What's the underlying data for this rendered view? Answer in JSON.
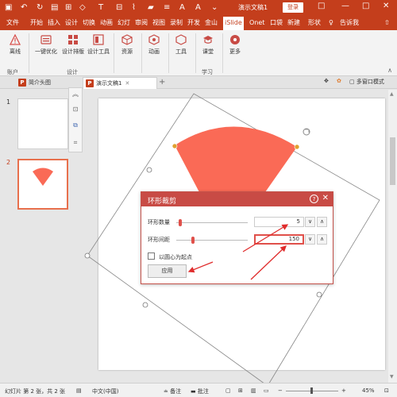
{
  "app": {
    "doc_title": "演示文稿1",
    "login_label": "登录",
    "ribbon_display_label": "□",
    "min_label": "—",
    "max_label": "□",
    "close_label": "✕",
    "save_icon": "save-icon",
    "undo_icon": "undo-icon"
  },
  "tabs": [
    {
      "label": "文件"
    },
    {
      "label": "开始"
    },
    {
      "label": "插入"
    },
    {
      "label": "设计"
    },
    {
      "label": "切换"
    },
    {
      "label": "动画"
    },
    {
      "label": "幻灯"
    },
    {
      "label": "审阅"
    },
    {
      "label": "视图"
    },
    {
      "label": "录制"
    },
    {
      "label": "开发"
    },
    {
      "label": "金山"
    },
    {
      "label": "iSlide"
    },
    {
      "label": "Onet"
    },
    {
      "label": "口袋"
    },
    {
      "label": "新建"
    },
    {
      "label": "形状"
    },
    {
      "label": "告诉我"
    }
  ],
  "ribbon": {
    "logout_label": "离线",
    "account_group": "账户",
    "optimize_label": "一键优化",
    "layout_label": "设计排版",
    "tools_label": "设计工具",
    "design_group": "设计",
    "resources_label": "资源",
    "animation_label": "动画",
    "tools2_label": "工具",
    "course_label": "课堂",
    "study_group": "学习",
    "more_label": "更多"
  },
  "docbar": {
    "tab1": "简介头图",
    "tab2": "演示文稿1",
    "add_label": "+",
    "multi_window": "多窗口模式"
  },
  "thumbs": {
    "num1": "1",
    "num2": "2"
  },
  "dialog": {
    "title": "环形裁剪",
    "help": "?",
    "close": "✕",
    "count_label": "环形数量",
    "count_value": "5",
    "spacing_label": "环形间距",
    "spacing_value": "150",
    "checkbox_label": "以圆心为起点",
    "apply_label": "应用",
    "spin_down": "∨",
    "spin_up": "∧"
  },
  "status": {
    "slide_info": "幻灯片 第 2 张，共 2 张",
    "language": "中文(中国)",
    "notes_label": "备注",
    "comments_label": "批注",
    "zoom_minus": "−",
    "zoom_plus": "+",
    "zoom_value": "45%"
  },
  "colors": {
    "accent": "#c43e1c",
    "shape": "#fa6a56",
    "dialog_head": "#c84b45"
  }
}
